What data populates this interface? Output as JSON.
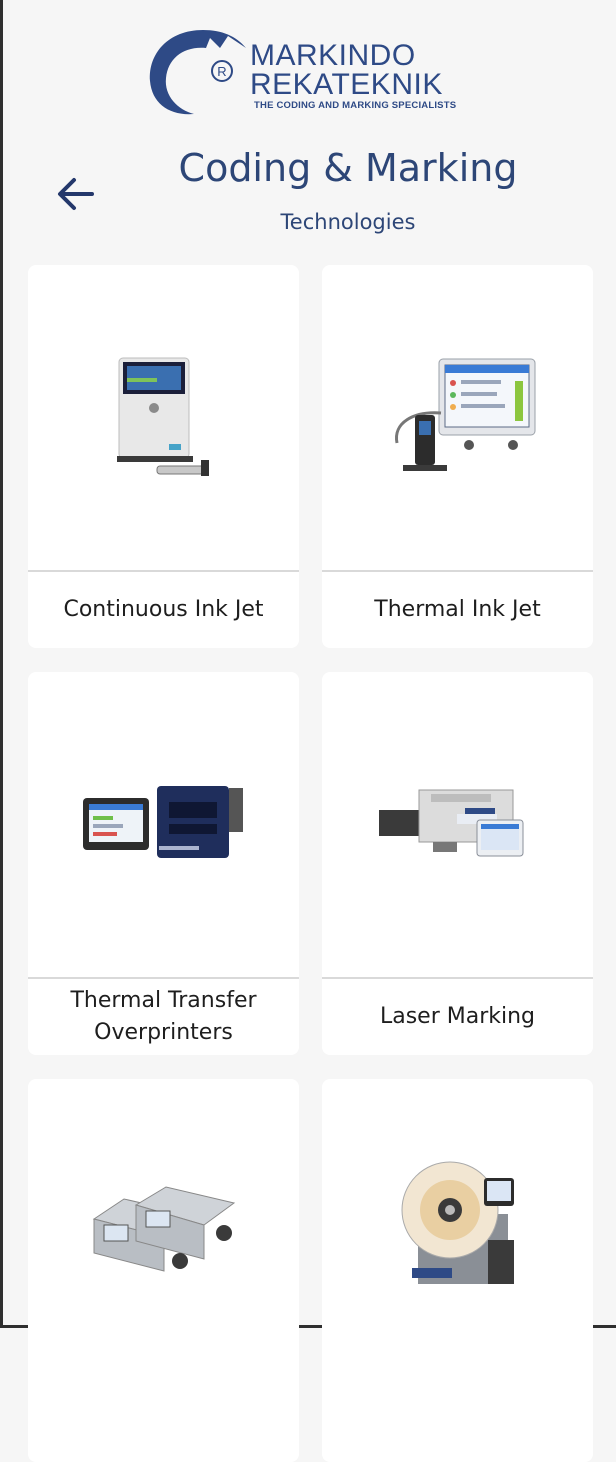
{
  "brand": {
    "line1": "MARKINDO",
    "line2": "REKATEKNIK",
    "tagline": "THE CODING AND MARKING SPECIALISTS",
    "registered_mark": "®",
    "color": "#2e4a86"
  },
  "header": {
    "title": "Coding & Marking",
    "subtitle": "Technologies",
    "back_icon": "arrow-left-icon"
  },
  "products": [
    {
      "label": "Continuous Ink Jet",
      "icon": "cij-printer-image"
    },
    {
      "label": "Thermal Ink Jet",
      "icon": "tij-printer-image"
    },
    {
      "label": "Thermal Transfer Overprinters",
      "icon": "tto-printer-image"
    },
    {
      "label": "Laser Marking",
      "icon": "laser-marker-image"
    },
    {
      "label": "",
      "icon": "case-coder-image"
    },
    {
      "label": "",
      "icon": "label-applicator-image"
    }
  ],
  "colors": {
    "accent": "#2d4677",
    "background": "#f6f6f6",
    "card": "#ffffff"
  }
}
